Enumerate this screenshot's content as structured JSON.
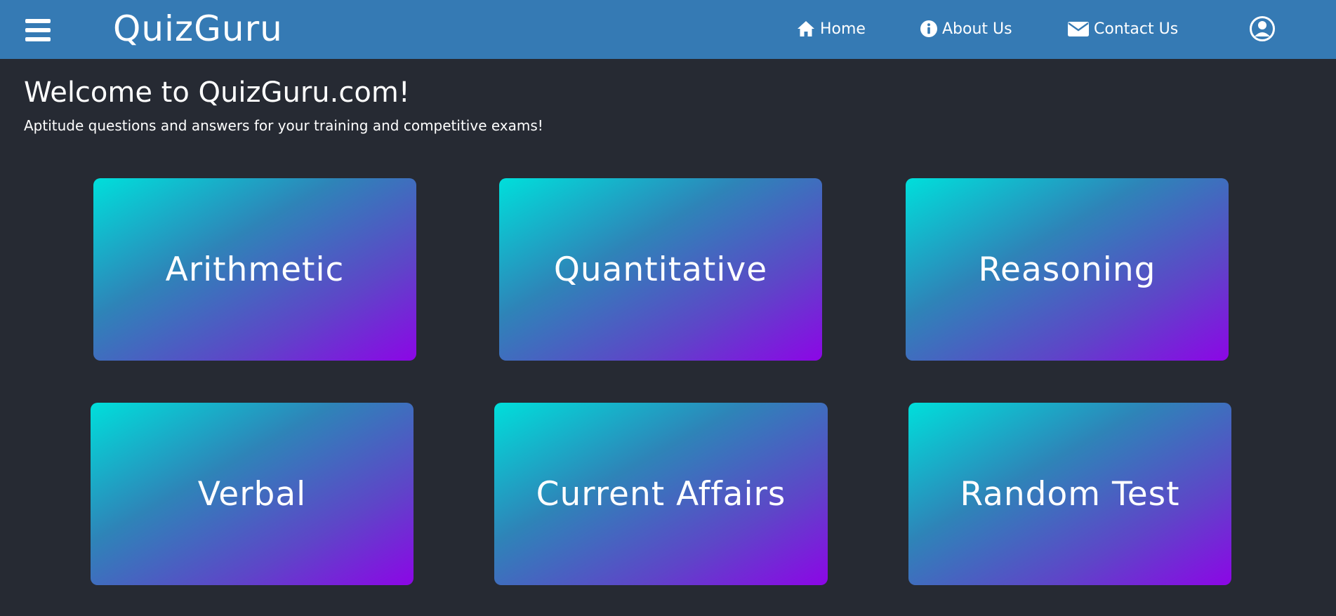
{
  "app": {
    "brand": "QuizGuru"
  },
  "nav": {
    "menu_icon": "hamburger-menu-icon",
    "items": [
      {
        "label": "Home",
        "icon": "home-icon"
      },
      {
        "label": "About Us",
        "icon": "info-icon"
      },
      {
        "label": "Contact Us",
        "icon": "envelope-icon"
      }
    ],
    "account_icon": "user-circle-icon"
  },
  "hero": {
    "title": "Welcome to QuizGuru.com!",
    "subtitle": "Aptitude questions and answers for your training and competitive exams!"
  },
  "categories": [
    {
      "label": "Arithmetic"
    },
    {
      "label": "Quantitative"
    },
    {
      "label": "Reasoning"
    },
    {
      "label": "Verbal"
    },
    {
      "label": "Current Affairs"
    },
    {
      "label": "Random Test"
    }
  ],
  "colors": {
    "navbar": "#357ab4",
    "background": "#262a33",
    "card_gradient_start": "#00dfdb",
    "card_gradient_end": "#8c06e6",
    "text": "#ffffff"
  }
}
